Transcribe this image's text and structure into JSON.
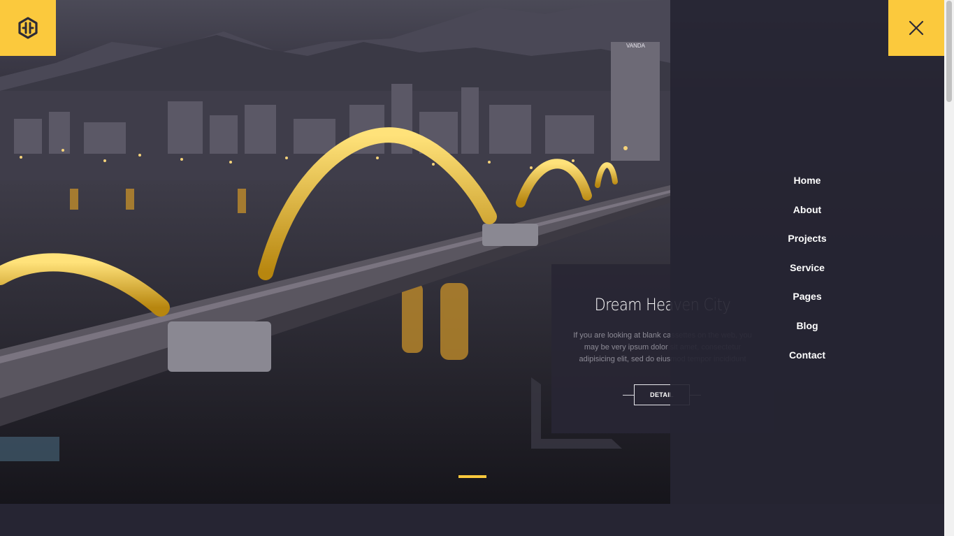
{
  "colors": {
    "accent": "#fbc93d",
    "panel": "#262533"
  },
  "header": {
    "logo_icon": "hexagon-logo-icon",
    "close_icon": "close-icon"
  },
  "hero": {
    "hotel_sign": "VANDA",
    "caption": {
      "title": "Dream Heaven City",
      "text": "If you are looking at blank cassettes on the web, you may be very ipsum dolor sit amet, consectetur adipisicing elit, sed do eiusmod tempor incididunt",
      "button_label": "DETAIL"
    }
  },
  "nav": {
    "items": [
      "Home",
      "About",
      "Projects",
      "Service",
      "Pages",
      "Blog",
      "Contact"
    ]
  }
}
